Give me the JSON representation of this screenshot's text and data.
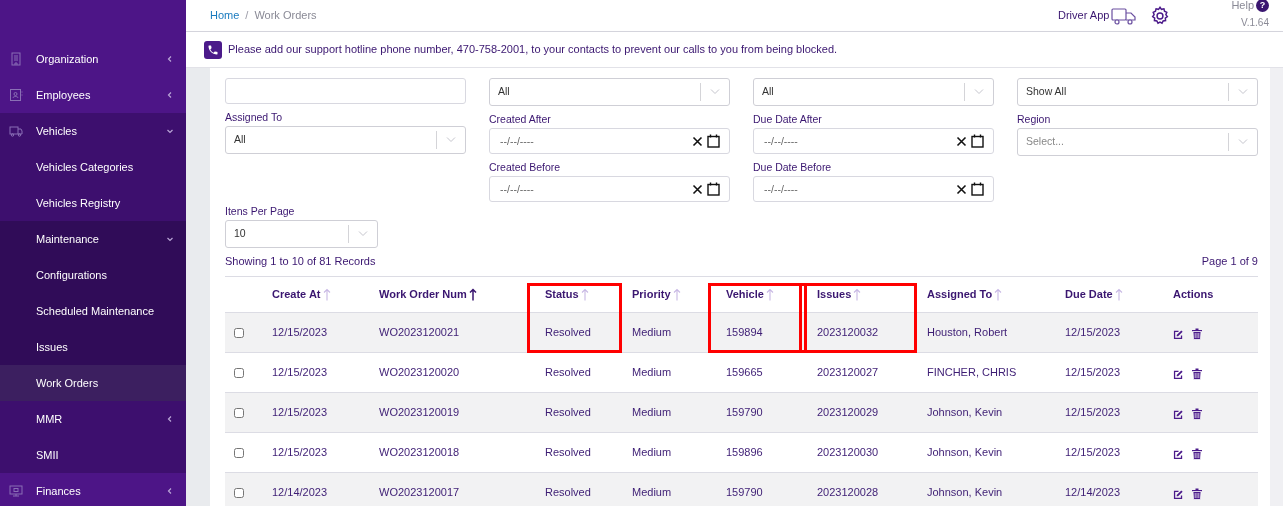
{
  "sidebar": {
    "items": [
      {
        "label": "Organization",
        "expanded": false,
        "has_arrow": true,
        "selected": false
      },
      {
        "label": "Employees",
        "expanded": false,
        "has_arrow": true,
        "selected": false
      },
      {
        "label": "Vehicles",
        "expanded": true,
        "has_arrow": true,
        "selected": false,
        "children": [
          {
            "label": "Vehicles Categories",
            "selected": false
          },
          {
            "label": "Vehicles Registry",
            "selected": false
          },
          {
            "label": "Maintenance",
            "expanded": true,
            "has_arrow": true,
            "selected": false,
            "children": [
              {
                "label": "Configurations",
                "selected": false
              },
              {
                "label": "Scheduled Maintenance",
                "selected": false
              },
              {
                "label": "Issues",
                "selected": false
              },
              {
                "label": "Work Orders",
                "selected": true
              }
            ]
          },
          {
            "label": "MMR",
            "expanded": false,
            "has_arrow": true,
            "selected": false
          },
          {
            "label": "SMII",
            "selected": false
          }
        ]
      },
      {
        "label": "Finances",
        "expanded": false,
        "has_arrow": true,
        "selected": false
      }
    ]
  },
  "breadcrumb": {
    "items": [
      "Home",
      "Work Orders"
    ],
    "separator": "/"
  },
  "header": {
    "driver_app": "Driver App",
    "help": "Help",
    "help_icon": "?",
    "version": "V.1.64"
  },
  "banner": "Please add our support hotline phone number, 470-758-2001, to your contacts to prevent our calls to you from being blocked.",
  "filter_columns": [
    [
      {
        "kind": "text"
      },
      {
        "kind": "select",
        "label": "Assigned To",
        "value": "All"
      }
    ],
    [
      {
        "kind": "select",
        "value": "All"
      },
      {
        "kind": "date",
        "label": "Created After",
        "placeholder": "--/--/----"
      },
      {
        "kind": "date",
        "label": "Created Before",
        "placeholder": "--/--/----"
      }
    ],
    [
      {
        "kind": "select",
        "value": "All"
      },
      {
        "kind": "date",
        "label": "Due Date After",
        "placeholder": "--/--/----"
      },
      {
        "kind": "date",
        "label": "Due Date Before",
        "placeholder": "--/--/----"
      }
    ],
    [
      {
        "kind": "select",
        "value": "Show All"
      },
      {
        "kind": "select",
        "label": "Region",
        "placeholder": "Select..."
      }
    ]
  ],
  "items_per_page": {
    "label": "Itens Per Page",
    "value": "10"
  },
  "summary": "Showing 1 to 10 of 81 Records",
  "page_info": "Page 1 of 9",
  "table": {
    "columns": [
      {
        "label": "Create At",
        "sortable": true,
        "sort_active": false,
        "highlighted": false
      },
      {
        "label": "Work Order Num",
        "sortable": true,
        "sort_active": true,
        "highlighted": false
      },
      {
        "label": "Status",
        "sortable": true,
        "sort_active": false,
        "highlighted": true
      },
      {
        "label": "Priority",
        "sortable": true,
        "sort_active": false,
        "highlighted": false
      },
      {
        "label": "Vehicle",
        "sortable": true,
        "sort_active": false,
        "highlighted": true
      },
      {
        "label": "Issues",
        "sortable": true,
        "sort_active": false,
        "highlighted": true
      },
      {
        "label": "Assigned To",
        "sortable": true,
        "sort_active": false,
        "highlighted": false
      },
      {
        "label": "Due Date",
        "sortable": true,
        "sort_active": false,
        "highlighted": false
      },
      {
        "label": "Actions",
        "sortable": false,
        "highlighted": false
      }
    ],
    "rows": [
      {
        "checked": false,
        "cells": [
          "12/15/2023",
          "WO2023120021",
          "Resolved",
          "Medium",
          "159894",
          "2023120032",
          "Houston, Robert",
          "12/15/2023"
        ]
      },
      {
        "checked": false,
        "cells": [
          "12/15/2023",
          "WO2023120020",
          "Resolved",
          "Medium",
          "159665",
          "2023120027",
          "FINCHER, CHRIS",
          "12/15/2023"
        ]
      },
      {
        "checked": false,
        "cells": [
          "12/15/2023",
          "WO2023120019",
          "Resolved",
          "Medium",
          "159790",
          "2023120029",
          "Johnson, Kevin",
          "12/15/2023"
        ]
      },
      {
        "checked": false,
        "cells": [
          "12/15/2023",
          "WO2023120018",
          "Resolved",
          "Medium",
          "159896",
          "2023120030",
          "Johnson, Kevin",
          "12/15/2023"
        ]
      },
      {
        "checked": false,
        "cells": [
          "12/14/2023",
          "WO2023120017",
          "Resolved",
          "Medium",
          "159790",
          "2023120028",
          "Johnson, Kevin",
          "12/14/2023"
        ]
      }
    ]
  }
}
